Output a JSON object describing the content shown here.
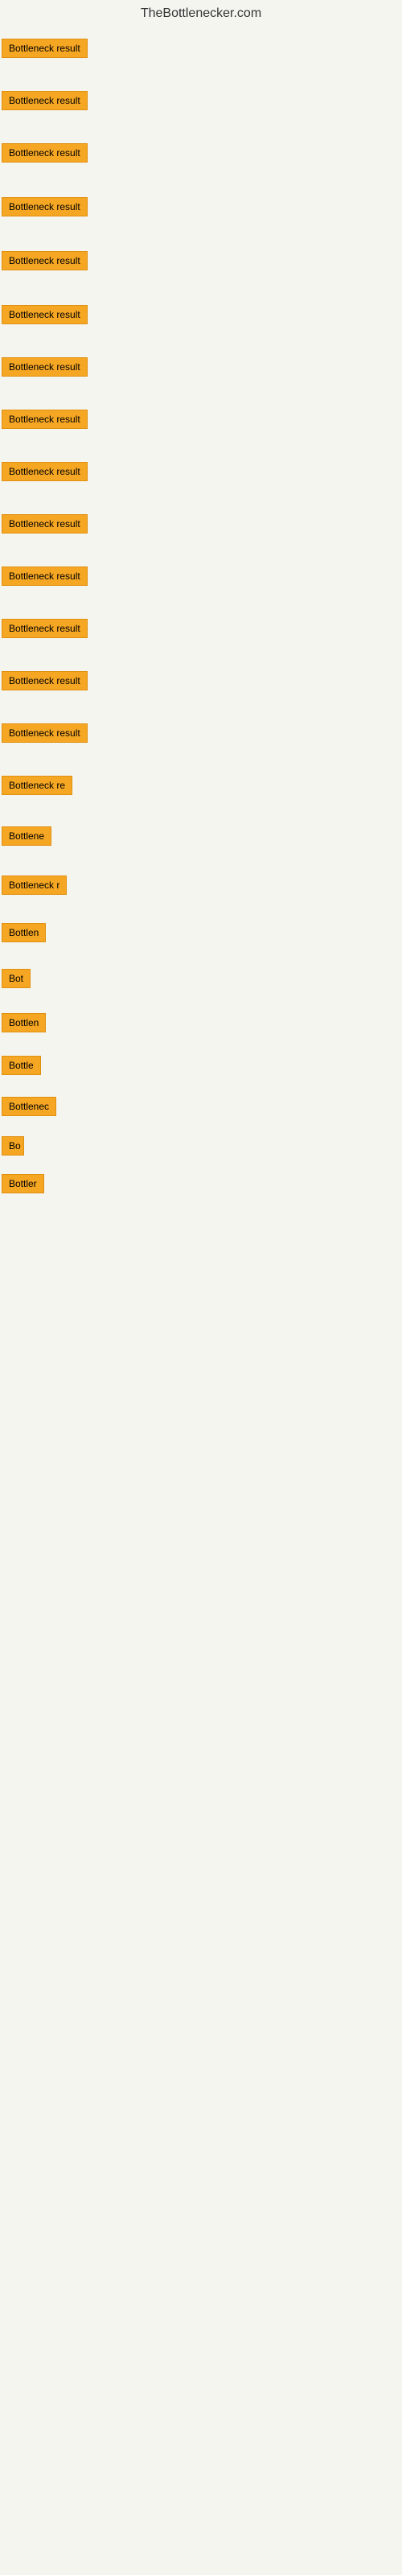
{
  "site": {
    "title": "TheBottlenecker.com"
  },
  "items": [
    {
      "id": 0,
      "label": "Bottleneck result",
      "width": 120
    },
    {
      "id": 1,
      "label": "Bottleneck result",
      "width": 120
    },
    {
      "id": 2,
      "label": "Bottleneck result",
      "width": 120
    },
    {
      "id": 3,
      "label": "Bottleneck result",
      "width": 120
    },
    {
      "id": 4,
      "label": "Bottleneck result",
      "width": 120
    },
    {
      "id": 5,
      "label": "Bottleneck result",
      "width": 120
    },
    {
      "id": 6,
      "label": "Bottleneck result",
      "width": 120
    },
    {
      "id": 7,
      "label": "Bottleneck result",
      "width": 120
    },
    {
      "id": 8,
      "label": "Bottleneck result",
      "width": 120
    },
    {
      "id": 9,
      "label": "Bottleneck result",
      "width": 120
    },
    {
      "id": 10,
      "label": "Bottleneck result",
      "width": 120
    },
    {
      "id": 11,
      "label": "Bottleneck result",
      "width": 120
    },
    {
      "id": 12,
      "label": "Bottleneck result",
      "width": 120
    },
    {
      "id": 13,
      "label": "Bottleneck result",
      "width": 120
    },
    {
      "id": 14,
      "label": "Bottleneck re",
      "width": 95
    },
    {
      "id": 15,
      "label": "Bottlene",
      "width": 72
    },
    {
      "id": 16,
      "label": "Bottleneck r",
      "width": 82
    },
    {
      "id": 17,
      "label": "Bottlen",
      "width": 64
    },
    {
      "id": 18,
      "label": "Bot",
      "width": 36
    },
    {
      "id": 19,
      "label": "Bottlen",
      "width": 64
    },
    {
      "id": 20,
      "label": "Bottle",
      "width": 54
    },
    {
      "id": 21,
      "label": "Bottlenec",
      "width": 76
    },
    {
      "id": 22,
      "label": "Bo",
      "width": 28
    },
    {
      "id": 23,
      "label": "Bottler",
      "width": 58
    }
  ]
}
